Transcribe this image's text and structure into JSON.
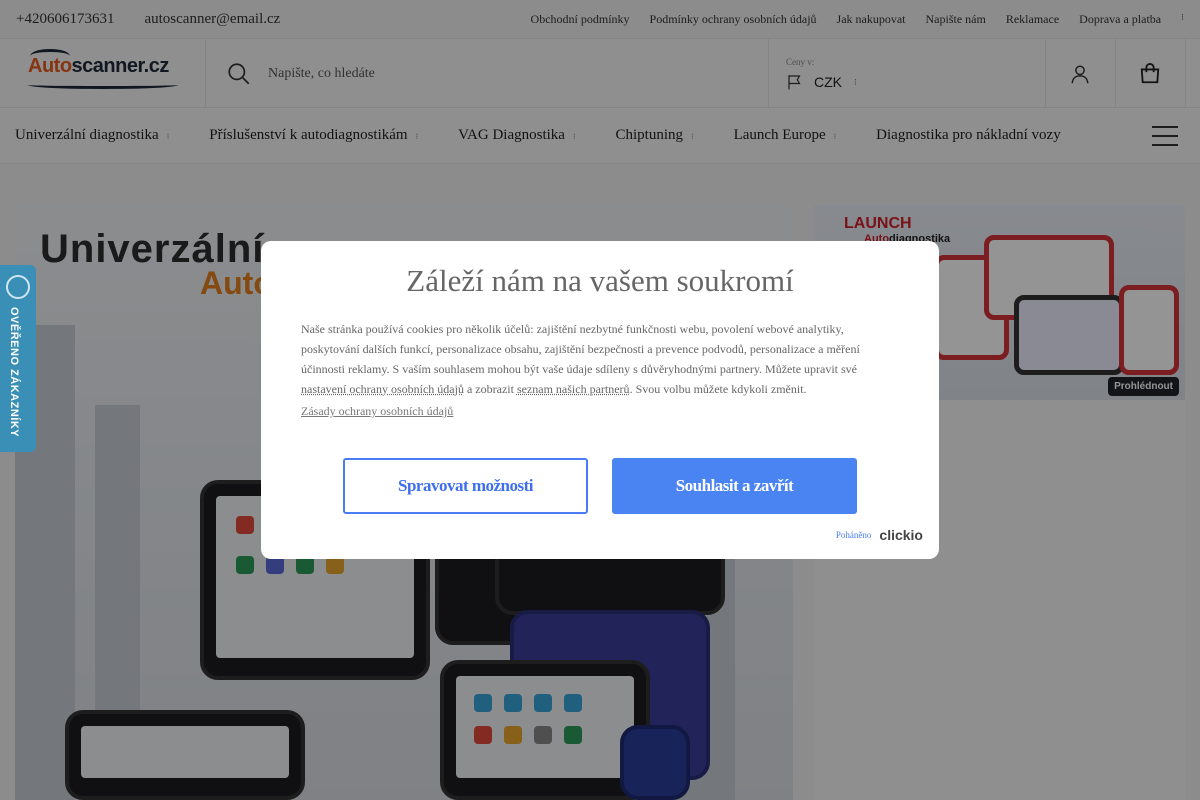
{
  "topbar": {
    "phone": "+420606173631",
    "email": "autoscanner@email.cz",
    "links": [
      "Obchodní podmínky",
      "Podmínky ochrany osobních údajů",
      "Jak nakupovat",
      "Napište nám",
      "Reklamace",
      "Doprava a platba"
    ]
  },
  "header": {
    "logo_part1": "Auto",
    "logo_part2": "scanner.cz",
    "search_placeholder": "Napište, co hledáte",
    "currency_label": "Ceny v:",
    "currency_value": "CZK"
  },
  "nav": {
    "items": [
      {
        "label": "Univerzální diagnostika"
      },
      {
        "label": "Příslušenství k autodiagnostikám"
      },
      {
        "label": "VAG Diagnostika"
      },
      {
        "label": "Chiptuning"
      },
      {
        "label": "Launch Europe"
      },
      {
        "label": "Diagnostika pro nákladní vozy"
      }
    ]
  },
  "banner_main": {
    "title_line1": "Univerzální",
    "title_line2": "Auto"
  },
  "banner_side": {
    "brand": "LAUNCH",
    "subtitle_accent": "Auto",
    "subtitle_rest": "diagnostika",
    "button": "Prohlédnout"
  },
  "verified_badge": {
    "text": "OVĚŘENO ZÁKAZNÍKY"
  },
  "modal": {
    "title": "Záleží nám na vašem soukromí",
    "body_part1": "Naše stránka používá cookies pro několik účelů: zajištění nezbytné funkčnosti webu, povolení webové analytiky, poskytování dalších funkcí, personalizace obsahu, zajištění bezpečnosti a prevence podvodů, personalizace a měření účinnosti reklamy. S vaším souhlasem mohou být vaše údaje sdíleny s důvěryhodnými partnery. Můžete upravit své ",
    "link_settings": "nastavení ochrany osobních údajů",
    "body_part2": " a zobrazit ",
    "link_partners": "seznam našich partnerů",
    "body_part3": ". Svou volbu můžete kdykoli změnit.",
    "policy_link": "Zásady ochrany osobních údajů",
    "manage_button": "Spravovat možnosti",
    "accept_button": "Souhlasit a zavřít",
    "powered_by": "Poháněno",
    "powered_brand": "clickio"
  }
}
